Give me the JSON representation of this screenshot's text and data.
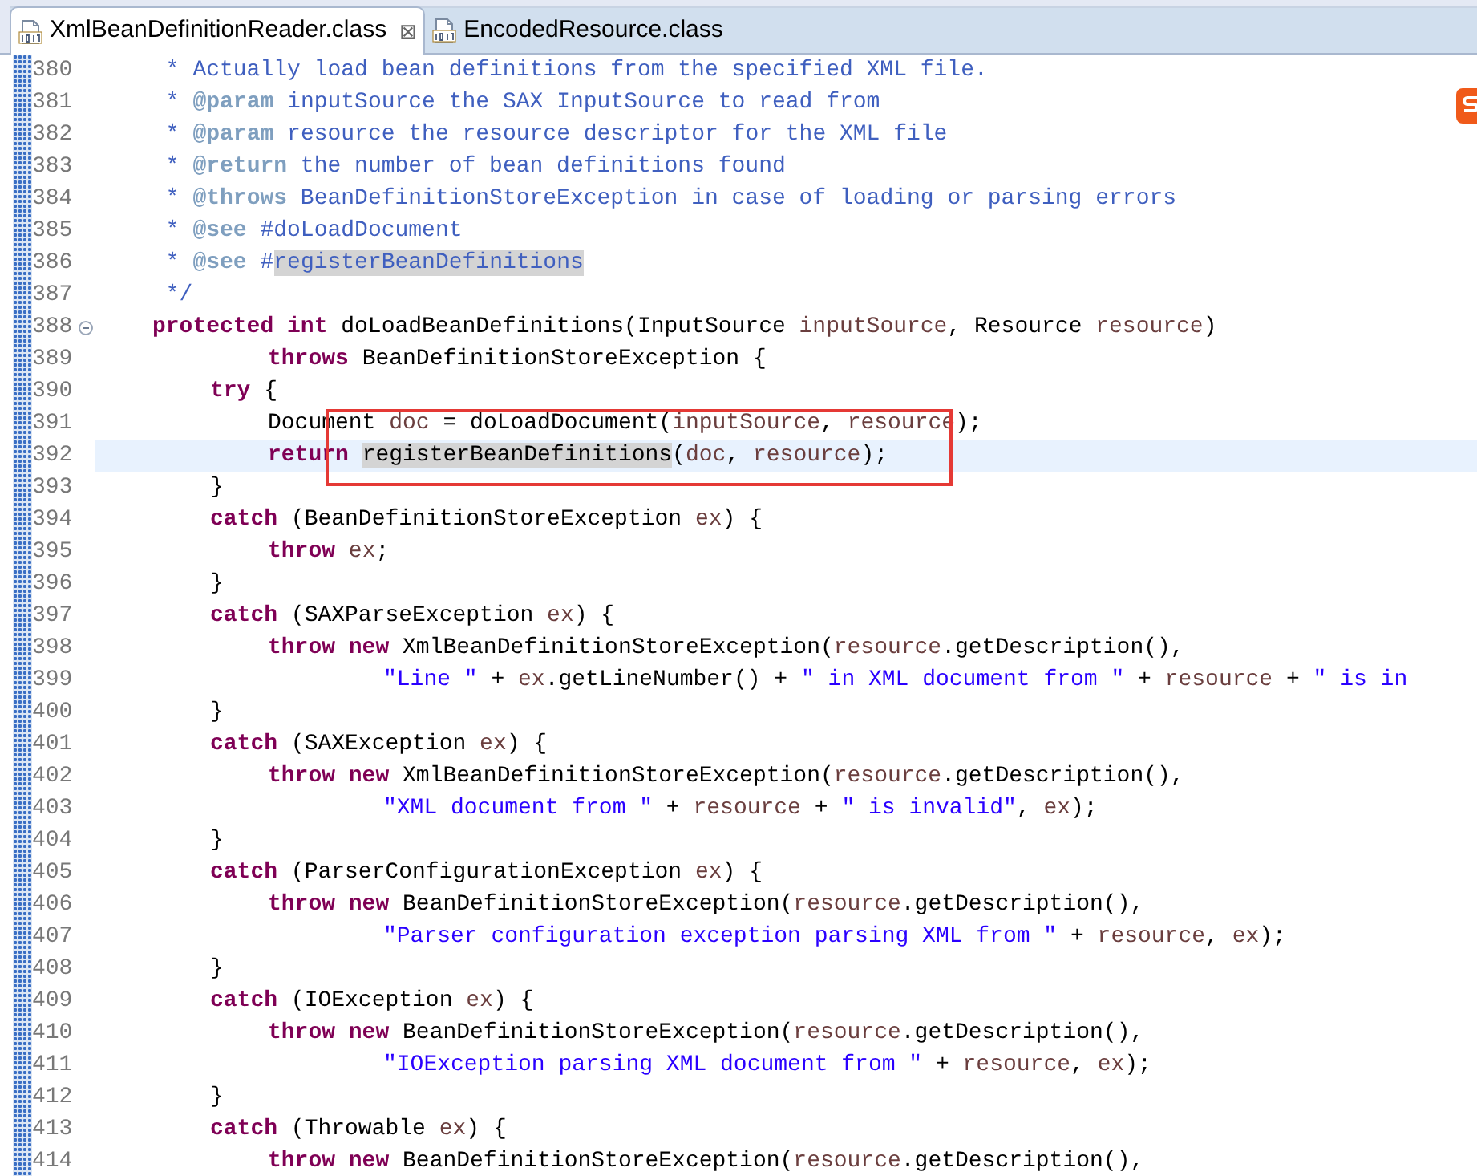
{
  "tabs": [
    {
      "label": "XmlBeanDefinitionReader.class",
      "selected": true,
      "close": "⊠"
    },
    {
      "label": "EncodedResource.class",
      "selected": false
    }
  ],
  "lines": [
    {
      "number": "380",
      "current": false,
      "foldable": false,
      "tokens": [
        {
          "kind": "doc",
          "text": "\t * Actually load bean definitions from the specified XML file."
        }
      ]
    },
    {
      "number": "381",
      "current": false,
      "foldable": false,
      "tokens": [
        {
          "kind": "doc",
          "text": "\t * "
        },
        {
          "kind": "doctag",
          "text": "@param"
        },
        {
          "kind": "doc",
          "text": " inputSource the SAX InputSource to read from"
        }
      ]
    },
    {
      "number": "382",
      "current": false,
      "foldable": false,
      "tokens": [
        {
          "kind": "doc",
          "text": "\t * "
        },
        {
          "kind": "doctag",
          "text": "@param"
        },
        {
          "kind": "doc",
          "text": " resource the resource descriptor for the XML file"
        }
      ]
    },
    {
      "number": "383",
      "current": false,
      "foldable": false,
      "tokens": [
        {
          "kind": "doc",
          "text": "\t * "
        },
        {
          "kind": "doctag",
          "text": "@return"
        },
        {
          "kind": "doc",
          "text": " the number of bean definitions found"
        }
      ]
    },
    {
      "number": "384",
      "current": false,
      "foldable": false,
      "tokens": [
        {
          "kind": "doc",
          "text": "\t * "
        },
        {
          "kind": "doctag",
          "text": "@throws"
        },
        {
          "kind": "doc",
          "text": " BeanDefinitionStoreException in case of loading or parsing errors"
        }
      ]
    },
    {
      "number": "385",
      "current": false,
      "foldable": false,
      "tokens": [
        {
          "kind": "doc",
          "text": "\t * "
        },
        {
          "kind": "doctag",
          "text": "@see"
        },
        {
          "kind": "doc",
          "text": " #doLoadDocument"
        }
      ]
    },
    {
      "number": "386",
      "current": false,
      "foldable": false,
      "tokens": [
        {
          "kind": "doc",
          "text": "\t * "
        },
        {
          "kind": "doctag",
          "text": "@see"
        },
        {
          "kind": "doc",
          "text": " #"
        },
        {
          "kind": "docmark",
          "text": "registerBeanDefinitions"
        }
      ]
    },
    {
      "number": "387",
      "current": false,
      "foldable": false,
      "tokens": [
        {
          "kind": "doc",
          "text": "\t */"
        }
      ]
    },
    {
      "number": "388",
      "current": false,
      "foldable": true,
      "tokens": [
        {
          "kind": "kw",
          "text": "\tprotected int"
        },
        {
          "kind": "plain",
          "text": " doLoadBeanDefinitions(InputSource "
        },
        {
          "kind": "var",
          "text": "inputSource"
        },
        {
          "kind": "plain",
          "text": ", Resource "
        },
        {
          "kind": "var",
          "text": "resource"
        },
        {
          "kind": "plain",
          "text": ")"
        }
      ]
    },
    {
      "number": "389",
      "current": false,
      "foldable": false,
      "tokens": [
        {
          "kind": "kw",
          "text": "\t\t\tthrows"
        },
        {
          "kind": "plain",
          "text": " BeanDefinitionStoreException {"
        }
      ]
    },
    {
      "number": "390",
      "current": false,
      "foldable": false,
      "tokens": [
        {
          "kind": "kw",
          "text": "\t\ttry"
        },
        {
          "kind": "plain",
          "text": " {"
        }
      ]
    },
    {
      "number": "391",
      "current": false,
      "foldable": false,
      "tokens": [
        {
          "kind": "plain",
          "text": "\t\t\tDocument "
        },
        {
          "kind": "var",
          "text": "doc"
        },
        {
          "kind": "plain",
          "text": " = doLoadDocument("
        },
        {
          "kind": "var",
          "text": "inputSource"
        },
        {
          "kind": "plain",
          "text": ", "
        },
        {
          "kind": "var",
          "text": "resource"
        },
        {
          "kind": "plain",
          "text": ");"
        }
      ]
    },
    {
      "number": "392",
      "current": true,
      "foldable": false,
      "tokens": [
        {
          "kind": "kw",
          "text": "\t\t\treturn "
        },
        {
          "kind": "mark",
          "text": "registerBeanDefinitions"
        },
        {
          "kind": "plain",
          "text": "("
        },
        {
          "kind": "var",
          "text": "doc"
        },
        {
          "kind": "plain",
          "text": ", "
        },
        {
          "kind": "var",
          "text": "resource"
        },
        {
          "kind": "plain",
          "text": ");"
        }
      ]
    },
    {
      "number": "393",
      "current": false,
      "foldable": false,
      "tokens": [
        {
          "kind": "plain",
          "text": "\t\t}"
        }
      ]
    },
    {
      "number": "394",
      "current": false,
      "foldable": false,
      "tokens": [
        {
          "kind": "kw",
          "text": "\t\tcatch"
        },
        {
          "kind": "plain",
          "text": " (BeanDefinitionStoreException "
        },
        {
          "kind": "var",
          "text": "ex"
        },
        {
          "kind": "plain",
          "text": ") {"
        }
      ]
    },
    {
      "number": "395",
      "current": false,
      "foldable": false,
      "tokens": [
        {
          "kind": "kw",
          "text": "\t\t\tthrow "
        },
        {
          "kind": "var",
          "text": "ex"
        },
        {
          "kind": "plain",
          "text": ";"
        }
      ]
    },
    {
      "number": "396",
      "current": false,
      "foldable": false,
      "tokens": [
        {
          "kind": "plain",
          "text": "\t\t}"
        }
      ]
    },
    {
      "number": "397",
      "current": false,
      "foldable": false,
      "tokens": [
        {
          "kind": "kw",
          "text": "\t\tcatch"
        },
        {
          "kind": "plain",
          "text": " (SAXParseException "
        },
        {
          "kind": "var",
          "text": "ex"
        },
        {
          "kind": "plain",
          "text": ") {"
        }
      ]
    },
    {
      "number": "398",
      "current": false,
      "foldable": false,
      "tokens": [
        {
          "kind": "kw",
          "text": "\t\t\tthrow new"
        },
        {
          "kind": "plain",
          "text": " XmlBeanDefinitionStoreException("
        },
        {
          "kind": "var",
          "text": "resource"
        },
        {
          "kind": "plain",
          "text": ".getDescription(),"
        }
      ]
    },
    {
      "number": "399",
      "current": false,
      "foldable": false,
      "tokens": [
        {
          "kind": "str",
          "text": "\t\t\t\t\t\"Line \""
        },
        {
          "kind": "plain",
          "text": " + "
        },
        {
          "kind": "var",
          "text": "ex"
        },
        {
          "kind": "plain",
          "text": ".getLineNumber() + "
        },
        {
          "kind": "str",
          "text": "\" in XML document from \""
        },
        {
          "kind": "plain",
          "text": " + "
        },
        {
          "kind": "var",
          "text": "resource"
        },
        {
          "kind": "plain",
          "text": " + "
        },
        {
          "kind": "str",
          "text": "\" is in"
        }
      ]
    },
    {
      "number": "400",
      "current": false,
      "foldable": false,
      "tokens": [
        {
          "kind": "plain",
          "text": "\t\t}"
        }
      ]
    },
    {
      "number": "401",
      "current": false,
      "foldable": false,
      "tokens": [
        {
          "kind": "kw",
          "text": "\t\tcatch"
        },
        {
          "kind": "plain",
          "text": " (SAXException "
        },
        {
          "kind": "var",
          "text": "ex"
        },
        {
          "kind": "plain",
          "text": ") {"
        }
      ]
    },
    {
      "number": "402",
      "current": false,
      "foldable": false,
      "tokens": [
        {
          "kind": "kw",
          "text": "\t\t\tthrow new"
        },
        {
          "kind": "plain",
          "text": " XmlBeanDefinitionStoreException("
        },
        {
          "kind": "var",
          "text": "resource"
        },
        {
          "kind": "plain",
          "text": ".getDescription(),"
        }
      ]
    },
    {
      "number": "403",
      "current": false,
      "foldable": false,
      "tokens": [
        {
          "kind": "str",
          "text": "\t\t\t\t\t\"XML document from \""
        },
        {
          "kind": "plain",
          "text": " + "
        },
        {
          "kind": "var",
          "text": "resource"
        },
        {
          "kind": "plain",
          "text": " + "
        },
        {
          "kind": "str",
          "text": "\" is invalid\""
        },
        {
          "kind": "plain",
          "text": ", "
        },
        {
          "kind": "var",
          "text": "ex"
        },
        {
          "kind": "plain",
          "text": ");"
        }
      ]
    },
    {
      "number": "404",
      "current": false,
      "foldable": false,
      "tokens": [
        {
          "kind": "plain",
          "text": "\t\t}"
        }
      ]
    },
    {
      "number": "405",
      "current": false,
      "foldable": false,
      "tokens": [
        {
          "kind": "kw",
          "text": "\t\tcatch"
        },
        {
          "kind": "plain",
          "text": " (ParserConfigurationException "
        },
        {
          "kind": "var",
          "text": "ex"
        },
        {
          "kind": "plain",
          "text": ") {"
        }
      ]
    },
    {
      "number": "406",
      "current": false,
      "foldable": false,
      "tokens": [
        {
          "kind": "kw",
          "text": "\t\t\tthrow new"
        },
        {
          "kind": "plain",
          "text": " BeanDefinitionStoreException("
        },
        {
          "kind": "var",
          "text": "resource"
        },
        {
          "kind": "plain",
          "text": ".getDescription(),"
        }
      ]
    },
    {
      "number": "407",
      "current": false,
      "foldable": false,
      "tokens": [
        {
          "kind": "str",
          "text": "\t\t\t\t\t\"Parser configuration exception parsing XML from \""
        },
        {
          "kind": "plain",
          "text": " + "
        },
        {
          "kind": "var",
          "text": "resource"
        },
        {
          "kind": "plain",
          "text": ", "
        },
        {
          "kind": "var",
          "text": "ex"
        },
        {
          "kind": "plain",
          "text": ");"
        }
      ]
    },
    {
      "number": "408",
      "current": false,
      "foldable": false,
      "tokens": [
        {
          "kind": "plain",
          "text": "\t\t}"
        }
      ]
    },
    {
      "number": "409",
      "current": false,
      "foldable": false,
      "tokens": [
        {
          "kind": "kw",
          "text": "\t\tcatch"
        },
        {
          "kind": "plain",
          "text": " (IOException "
        },
        {
          "kind": "var",
          "text": "ex"
        },
        {
          "kind": "plain",
          "text": ") {"
        }
      ]
    },
    {
      "number": "410",
      "current": false,
      "foldable": false,
      "tokens": [
        {
          "kind": "kw",
          "text": "\t\t\tthrow new"
        },
        {
          "kind": "plain",
          "text": " BeanDefinitionStoreException("
        },
        {
          "kind": "var",
          "text": "resource"
        },
        {
          "kind": "plain",
          "text": ".getDescription(),"
        }
      ]
    },
    {
      "number": "411",
      "current": false,
      "foldable": false,
      "tokens": [
        {
          "kind": "str",
          "text": "\t\t\t\t\t\"IOException parsing XML document from \""
        },
        {
          "kind": "plain",
          "text": " + "
        },
        {
          "kind": "var",
          "text": "resource"
        },
        {
          "kind": "plain",
          "text": ", "
        },
        {
          "kind": "var",
          "text": "ex"
        },
        {
          "kind": "plain",
          "text": ");"
        }
      ]
    },
    {
      "number": "412",
      "current": false,
      "foldable": false,
      "tokens": [
        {
          "kind": "plain",
          "text": "\t\t}"
        }
      ]
    },
    {
      "number": "413",
      "current": false,
      "foldable": false,
      "tokens": [
        {
          "kind": "kw",
          "text": "\t\tcatch"
        },
        {
          "kind": "plain",
          "text": " (Throwable "
        },
        {
          "kind": "var",
          "text": "ex"
        },
        {
          "kind": "plain",
          "text": ") {"
        }
      ]
    },
    {
      "number": "414",
      "current": false,
      "foldable": false,
      "tokens": [
        {
          "kind": "kw",
          "text": "\t\t\tthrow new"
        },
        {
          "kind": "plain",
          "text": " BeanDefinitionStoreException("
        },
        {
          "kind": "var",
          "text": "resource"
        },
        {
          "kind": "plain",
          "text": ".getDescription(),"
        }
      ]
    }
  ]
}
